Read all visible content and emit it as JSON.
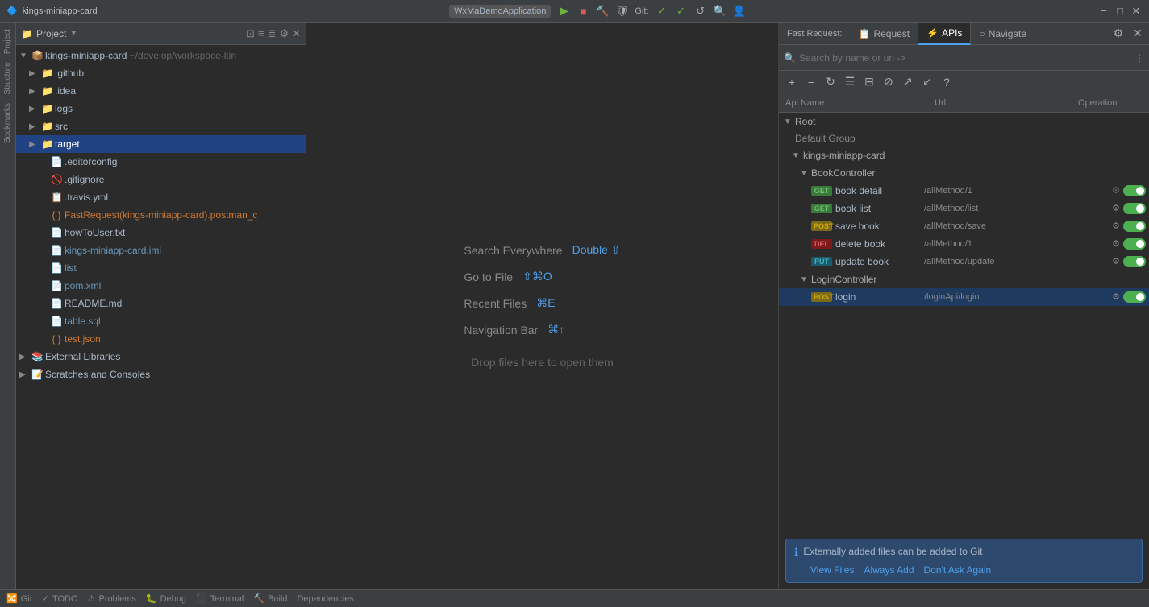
{
  "titleBar": {
    "appName": "kings-miniapp-card",
    "appBadge": "WxMaDemoApplication",
    "gitLabel": "Git:",
    "closeLabel": "✕",
    "minLabel": "−",
    "maxLabel": "□"
  },
  "projectPanel": {
    "title": "Project",
    "rootItem": "kings-miniapp-card",
    "rootPath": "~/develop/workspace-kin",
    "items": [
      {
        "label": ".github",
        "type": "folder",
        "indent": 1,
        "expanded": false
      },
      {
        "label": ".idea",
        "type": "folder",
        "indent": 1,
        "expanded": false
      },
      {
        "label": "logs",
        "type": "folder",
        "indent": 1,
        "expanded": false
      },
      {
        "label": "src",
        "type": "folder",
        "indent": 1,
        "expanded": false
      },
      {
        "label": "target",
        "type": "folder-orange",
        "indent": 1,
        "expanded": false,
        "selected": true
      },
      {
        "label": ".editorconfig",
        "type": "file",
        "indent": 2
      },
      {
        "label": ".gitignore",
        "type": "file",
        "indent": 2
      },
      {
        "label": ".travis.yml",
        "type": "yml",
        "indent": 2
      },
      {
        "label": "FastRequest(kings-miniapp-card).postman_c",
        "type": "json",
        "indent": 2
      },
      {
        "label": "howToUser.txt",
        "type": "txt",
        "indent": 2
      },
      {
        "label": "kings-miniapp-card.iml",
        "type": "xml",
        "indent": 2
      },
      {
        "label": "list",
        "type": "file-blue",
        "indent": 2
      },
      {
        "label": "pom.xml",
        "type": "xml",
        "indent": 2
      },
      {
        "label": "README.md",
        "type": "md",
        "indent": 2
      },
      {
        "label": "table.sql",
        "type": "sql",
        "indent": 2
      },
      {
        "label": "test.json",
        "type": "json",
        "indent": 2
      },
      {
        "label": "External Libraries",
        "type": "library",
        "indent": 0,
        "expanded": false
      },
      {
        "label": "Scratches and Consoles",
        "type": "scratch",
        "indent": 0
      }
    ]
  },
  "editor": {
    "searchEverywhereLabel": "Search Everywhere",
    "searchEverywhereShortcut": "Double ⇧",
    "goToFileLabel": "Go to File",
    "goToFileShortcut": "⇧⌘O",
    "recentFilesLabel": "Recent Files",
    "recentFilesShortcut": "⌘E",
    "navigationBarLabel": "Navigation Bar",
    "navigationBarShortcut": "⌘↑",
    "dropFilesLabel": "Drop files here to open them"
  },
  "fastRequest": {
    "panelLabel": "Fast Request:",
    "tabs": [
      {
        "label": "Request",
        "icon": "📋",
        "active": false
      },
      {
        "label": "APIs",
        "icon": "⚡",
        "active": true
      },
      {
        "label": "Navigate",
        "icon": "○",
        "active": false
      }
    ],
    "searchPlaceholder": "Search by name or url ->",
    "settingsIcon": "⚙",
    "closeIcon": "✕",
    "columns": {
      "apiName": "Api Name",
      "url": "Url",
      "operation": "Operation"
    },
    "tree": {
      "root": "Root",
      "defaultGroup": "Default Group",
      "controllers": [
        {
          "name": "kings-miniapp-card",
          "expanded": true,
          "children": [
            {
              "name": "BookController",
              "expanded": true,
              "items": [
                {
                  "method": "GET",
                  "name": "book detail",
                  "url": "/allMethod/1"
                },
                {
                  "method": "GET",
                  "name": "book list",
                  "url": "/allMethod/list"
                },
                {
                  "method": "POST",
                  "name": "save book",
                  "url": "/allMethod/save"
                },
                {
                  "method": "DEL",
                  "name": "delete book",
                  "url": "/allMethod/1"
                },
                {
                  "method": "PUT",
                  "name": "update book",
                  "url": "/allMethod/update"
                }
              ]
            },
            {
              "name": "LoginController",
              "expanded": true,
              "items": [
                {
                  "method": "POST",
                  "name": "login",
                  "url": "/loginApi/login",
                  "selected": true
                }
              ]
            }
          ]
        }
      ]
    },
    "gitNotification": {
      "text": "Externally added files can be added to Git",
      "actions": [
        "View Files",
        "Always Add",
        "Don't Ask Again"
      ]
    }
  },
  "statusBar": {
    "items": [
      "Git",
      "TODO",
      "Problems",
      "Debug",
      "Terminal",
      "Build",
      "Dependencies"
    ]
  }
}
